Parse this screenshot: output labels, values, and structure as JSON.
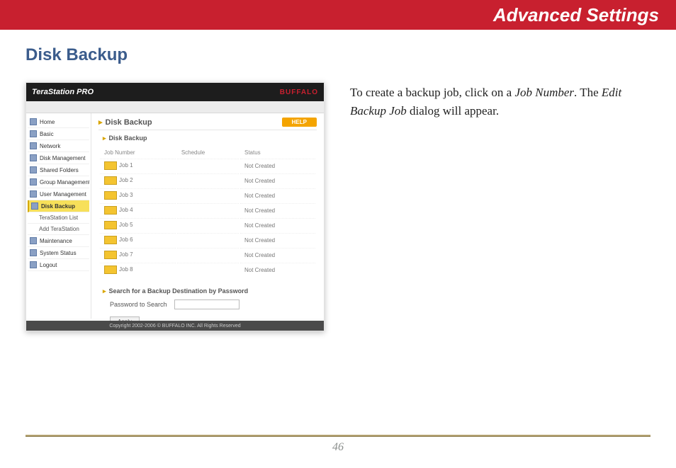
{
  "header": {
    "title": "Advanced Settings"
  },
  "section": {
    "title": "Disk Backup"
  },
  "instruction": {
    "prefix": "To create a backup job, click on a ",
    "em1": "Job Number",
    "mid": ". The ",
    "em2": "Edit Backup Job",
    "suffix": " dialog will appear."
  },
  "app": {
    "logo": "TeraStation PRO",
    "brand": "BUFFALO",
    "panel_title": "Disk Backup",
    "help_label": "HELP",
    "sub_head": "Disk Backup",
    "columns": {
      "job": "Job Number",
      "schedule": "Schedule",
      "status": "Status"
    },
    "jobs": [
      {
        "label": "Job 1",
        "status": "Not Created"
      },
      {
        "label": "Job 2",
        "status": "Not Created"
      },
      {
        "label": "Job 3",
        "status": "Not Created"
      },
      {
        "label": "Job 4",
        "status": "Not Created"
      },
      {
        "label": "Job 5",
        "status": "Not Created"
      },
      {
        "label": "Job 6",
        "status": "Not Created"
      },
      {
        "label": "Job 7",
        "status": "Not Created"
      },
      {
        "label": "Job 8",
        "status": "Not Created"
      }
    ],
    "search_head": "Search for a Backup Destination by Password",
    "search_label": "Password to Search",
    "apply_label": "Apply",
    "footer": "Copyright 2002-2006 © BUFFALO INC. All Rights Reserved",
    "sidebar": [
      {
        "label": "Home"
      },
      {
        "label": "Basic"
      },
      {
        "label": "Network"
      },
      {
        "label": "Disk Management"
      },
      {
        "label": "Shared Folders"
      },
      {
        "label": "Group Management"
      },
      {
        "label": "User Management"
      },
      {
        "label": "Disk Backup",
        "selected": true
      },
      {
        "label": "TeraStation List",
        "sub": true
      },
      {
        "label": "Add TeraStation",
        "sub": true
      },
      {
        "label": "Maintenance"
      },
      {
        "label": "System Status"
      },
      {
        "label": "Logout"
      }
    ]
  },
  "page_number": "46"
}
